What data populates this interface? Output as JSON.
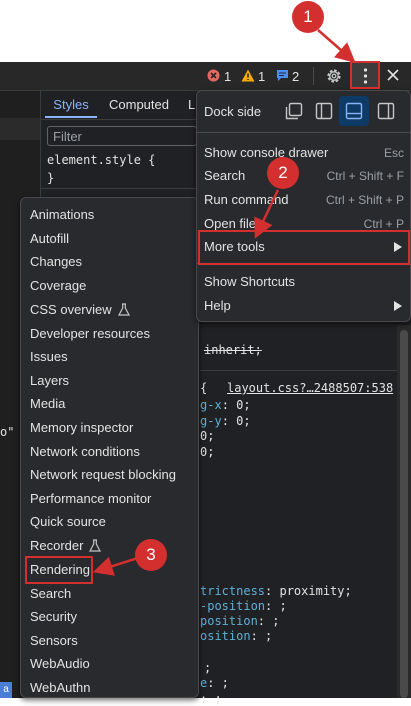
{
  "toolbar": {
    "errors": "1",
    "warnings": "1",
    "messages": "2"
  },
  "styles_pane": {
    "tab_styles": "Styles",
    "tab_computed": "Computed",
    "tab_clipped": "L",
    "filter_placeholder": "Filter",
    "element_style_open": "element.style {",
    "element_style_close": "}",
    "inherit_line": "inherit;",
    "layout_link": "layout.css?…2488507:538",
    "brace_open": "{",
    "lines": [
      {
        "prop": "g-x",
        "val": ": 0;"
      },
      {
        "prop": "g-y",
        "val": ": 0;"
      },
      {
        "prop": "",
        "val": "0;"
      },
      {
        "prop": "",
        "val": "0;"
      }
    ],
    "lines2": [
      {
        "prop": "trictness",
        "val": ": proximity;"
      },
      {
        "prop": "-position",
        "val": ": ;"
      },
      {
        "prop": "position",
        "val": ": ;"
      },
      {
        "prop": "osition",
        "val": ": ;"
      }
    ],
    "lines3": [
      {
        "prop": "",
        "val": ";"
      },
      {
        "prop": "e",
        "val": ": ;"
      },
      {
        "prop": "",
        "val": ": ;"
      }
    ],
    "left_mark": "o\"",
    "left_bottom": "a"
  },
  "main_menu": {
    "dock_side": "Dock side",
    "items": [
      {
        "label": "Show console drawer",
        "shortcut": "Esc"
      },
      {
        "label": "Search",
        "shortcut": "Ctrl + Shift + F"
      },
      {
        "label": "Run command",
        "shortcut": "Ctrl + Shift + P"
      },
      {
        "label": "Open file",
        "shortcut": "Ctrl + P"
      },
      {
        "label": "More tools",
        "shortcut": ""
      },
      {
        "label": "Show Shortcuts",
        "shortcut": ""
      },
      {
        "label": "Help",
        "shortcut": ""
      }
    ]
  },
  "more_tools_menu": {
    "items": [
      {
        "label": "Animations"
      },
      {
        "label": "Autofill"
      },
      {
        "label": "Changes"
      },
      {
        "label": "Coverage"
      },
      {
        "label": "CSS overview"
      },
      {
        "label": "Developer resources"
      },
      {
        "label": "Issues"
      },
      {
        "label": "Layers"
      },
      {
        "label": "Media"
      },
      {
        "label": "Memory inspector"
      },
      {
        "label": "Network conditions"
      },
      {
        "label": "Network request blocking"
      },
      {
        "label": "Performance monitor"
      },
      {
        "label": "Quick source"
      },
      {
        "label": "Recorder"
      },
      {
        "label": "Rendering"
      },
      {
        "label": "Search"
      },
      {
        "label": "Security"
      },
      {
        "label": "Sensors"
      },
      {
        "label": "WebAudio"
      },
      {
        "label": "WebAuthn"
      }
    ]
  },
  "annotations": {
    "step1": "1",
    "step2": "2",
    "step3": "3",
    "color": "#d32f2f"
  },
  "icons": [
    "error-icon",
    "warning-icon",
    "message-icon",
    "gear-icon",
    "kebab-menu-icon",
    "close-icon",
    "dock-undock-icon",
    "dock-left-icon",
    "dock-bottom-icon",
    "dock-right-icon",
    "chevron-right-icon",
    "flask-icon"
  ]
}
